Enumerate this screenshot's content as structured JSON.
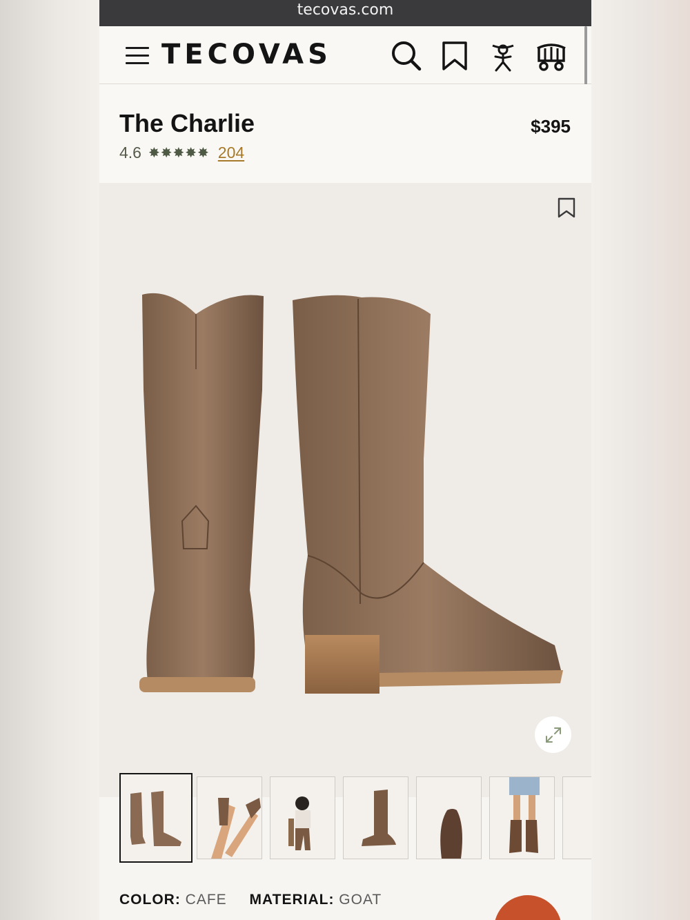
{
  "browser": {
    "url": "tecovas.com"
  },
  "header": {
    "logo": "TECOVAS"
  },
  "product": {
    "title": "The Charlie",
    "price": "$395",
    "rating": "4.6",
    "stars": "✸✸✸✸✸",
    "review_count": "204"
  },
  "attributes": {
    "color_label": "COLOR:",
    "color_value": "CAFE",
    "material_label": "MATERIAL:",
    "material_value": "GOAT"
  },
  "thumbnails": [
    {
      "name": "boots-pair"
    },
    {
      "name": "legs-kicking"
    },
    {
      "name": "model-seated"
    },
    {
      "name": "single-boot-side"
    },
    {
      "name": "boot-sole"
    },
    {
      "name": "legs-denim-shorts"
    }
  ],
  "colors": {
    "accent": "#a67a2a",
    "chat": "#c7512b",
    "boot": "#8a6a52"
  }
}
